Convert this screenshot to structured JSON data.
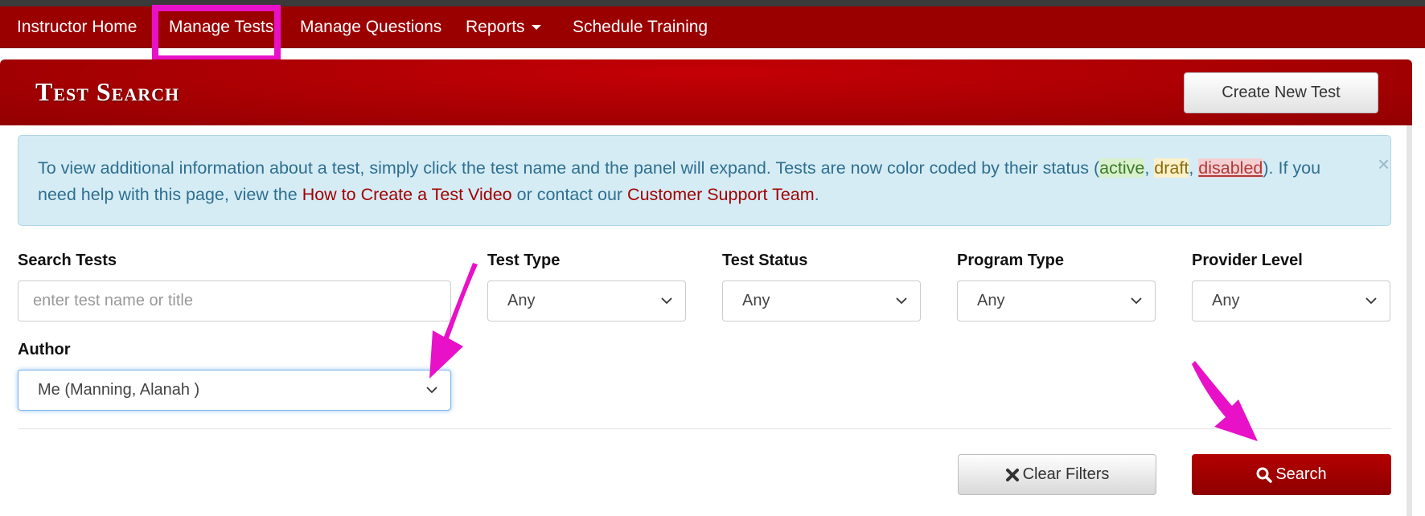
{
  "nav": {
    "items": [
      {
        "label": "Instructor Home"
      },
      {
        "label": "Manage Tests"
      },
      {
        "label": "Manage Questions"
      },
      {
        "label": "Reports"
      },
      {
        "label": "Schedule Training"
      }
    ]
  },
  "header": {
    "title": "Test Search",
    "create_button": "Create New Test"
  },
  "alert": {
    "text_1": "To view additional information about a test, simply click the test name and the panel will expand. Tests are now color coded by their status (",
    "status_active": "active",
    "sep_1": ", ",
    "status_draft": "draft",
    "sep_2": ", ",
    "status_disabled": "disabled",
    "text_2": "). If you need help with this page, view the ",
    "link_video": "How to Create a Test Video",
    "text_3": " or contact our ",
    "link_support": "Customer Support Team",
    "text_4": ".",
    "close": "×"
  },
  "filters": {
    "search": {
      "label": "Search Tests",
      "placeholder": "enter test name or title"
    },
    "test_type": {
      "label": "Test Type",
      "value": "Any"
    },
    "test_status": {
      "label": "Test Status",
      "value": "Any"
    },
    "program_type": {
      "label": "Program Type",
      "value": "Any"
    },
    "provider_level": {
      "label": "Provider Level",
      "value": "Any"
    },
    "author": {
      "label": "Author",
      "value": "Me (Manning, Alanah )"
    }
  },
  "actions": {
    "clear": "Clear Filters",
    "search": "Search"
  },
  "colors": {
    "nav_bg": "#9b0000",
    "annotation": "#e811c8",
    "search_btn": "#9e0000"
  },
  "icons": [
    "caret-down-icon",
    "close-icon",
    "chevron-down-icon",
    "times-icon",
    "magnifier-icon",
    "arrow-icon"
  ]
}
